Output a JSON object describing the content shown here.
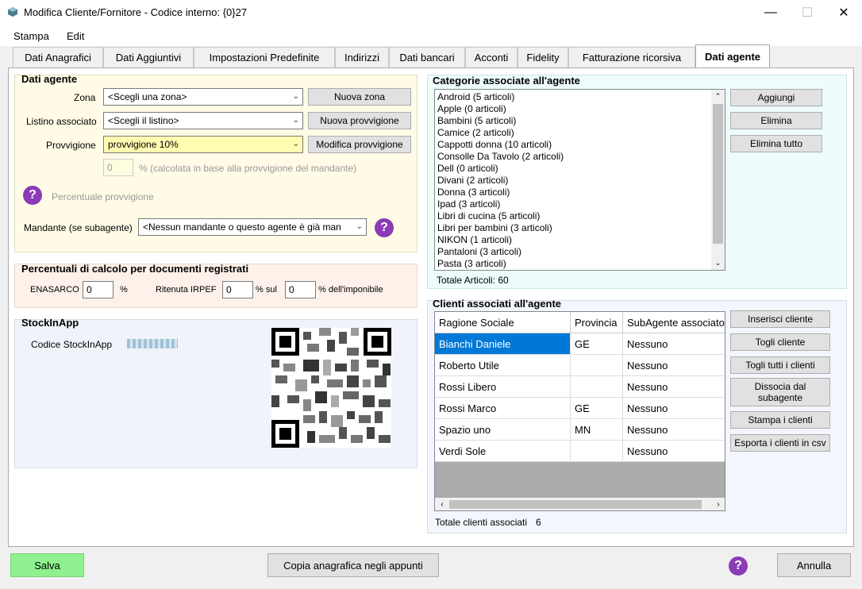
{
  "window": {
    "title": "Modifica Cliente/Fornitore - Codice interno: {0}27",
    "min": "—",
    "max": "☐",
    "close": "✕"
  },
  "menu": {
    "items": [
      "Stampa",
      "Edit"
    ]
  },
  "tabs": [
    "Dati Anagrafici",
    "Dati Aggiuntivi",
    "Impostazioni Predefinite",
    "Indirizzi",
    "Dati bancari",
    "Acconti",
    "Fidelity",
    "Fatturazione ricorsiva",
    "Dati agente"
  ],
  "dati_agente": {
    "title": "Dati agente",
    "zona_label": "Zona",
    "zona_value": "<Scegli una zona>",
    "nuova_zona": "Nuova zona",
    "listino_label": "Listino associato",
    "listino_value": "<Scegli il listino>",
    "nuova_provvigione": "Nuova provvigione",
    "provvigione_label": "Provvigione",
    "provvigione_value": "provvigione 10%",
    "modifica_provvigione": "Modifica provvigione",
    "percentuale_value": "0",
    "percentuale_note": "% (calcolata in base alla provvigione del mandante)",
    "percentuale_provvigione": "Percentuale provvigione",
    "mandante_label": "Mandante (se subagente)",
    "mandante_value": "<Nessun mandante o questo agente è già man"
  },
  "percentuali": {
    "title": "Percentuali di calcolo per documenti registrati",
    "enasarco_label": "ENASARCO",
    "enasarco_value": "0",
    "enasarco_unit": "%",
    "ritenuta_label": "Ritenuta IRPEF",
    "ritenuta_value": "0",
    "sul_label": "% sul",
    "imponibile_value": "0",
    "imponibile_label": "% dell'imponibile"
  },
  "stockinapp": {
    "title": "StockInApp",
    "codice_label": "Codice StockInApp"
  },
  "categorie": {
    "title": "Categorie associate all'agente",
    "items": [
      "Android (5 articoli)",
      "Apple (0 articoli)",
      "Bambini (5 articoli)",
      "Camice (2 articoli)",
      "Cappotti donna (10 articoli)",
      "Consolle Da Tavolo (2 articoli)",
      "Dell (0 articoli)",
      "Divani (2 articoli)",
      "Donna (3 articoli)",
      "Ipad (3 articoli)",
      "Libri di cucina (5 articoli)",
      "Libri per bambini (3 articoli)",
      "NIKON (1 articoli)",
      "Pantaloni (3 articoli)",
      "Pasta  (3 articoli)"
    ],
    "totale": "Totale Articoli: 60",
    "aggiungi": "Aggiungi",
    "elimina": "Elimina",
    "elimina_tutto": "Elimina tutto"
  },
  "clienti": {
    "title": "Clienti associati all'agente",
    "columns": [
      "Ragione Sociale",
      "Provincia",
      "SubAgente associato"
    ],
    "rows": [
      [
        "Bianchi Daniele",
        "GE",
        "Nessuno"
      ],
      [
        "Roberto Utile",
        "",
        "Nessuno"
      ],
      [
        "Rossi Libero",
        "",
        "Nessuno"
      ],
      [
        "Rossi Marco",
        "GE",
        "Nessuno"
      ],
      [
        "Spazio uno",
        "MN",
        "Nessuno"
      ],
      [
        "Verdi Sole",
        "",
        "Nessuno"
      ]
    ],
    "totale_label": "Totale clienti associati",
    "totale_value": "6",
    "buttons": [
      "Inserisci cliente",
      "Togli cliente",
      "Togli tutti i clienti",
      "Dissocia dal subagente",
      "Stampa i clienti",
      "Esporta i clienti in csv"
    ]
  },
  "footer": {
    "salva": "Salva",
    "copia": "Copia anagrafica negli appunti",
    "annulla": "Annulla"
  },
  "help": "?",
  "colors": {
    "salva_bg": "#8ef08e",
    "agente_bg": "#fffbe6",
    "percentuali_bg": "#fdf1ea",
    "stock_bg": "#f0f4fa",
    "categorie_bg": "#eefcfc",
    "clienti_bg": "#f3f7fd",
    "help": "#8a3bb5",
    "selection": "#0078d7"
  }
}
